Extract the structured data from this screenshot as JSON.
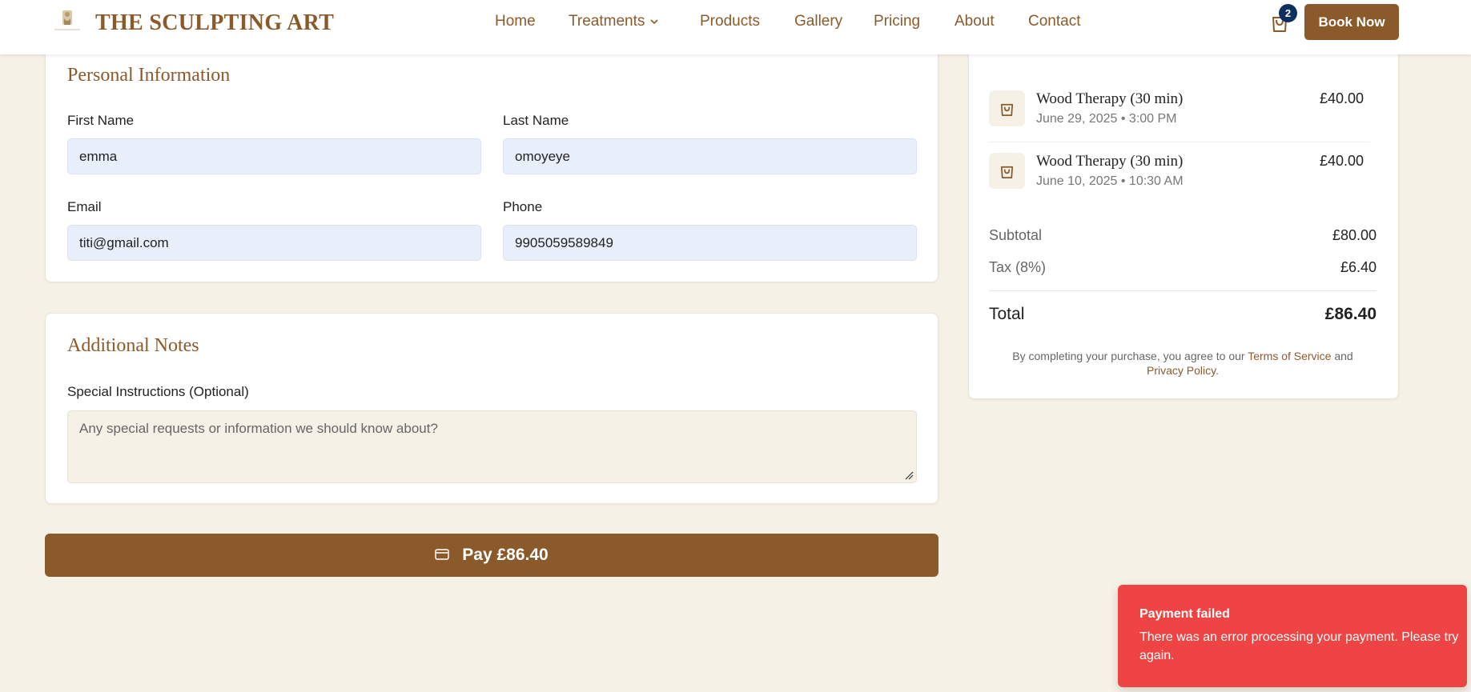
{
  "header": {
    "brand": "THE SCULPTING ART",
    "nav": [
      {
        "label": "Home"
      },
      {
        "label": "Treatments"
      },
      {
        "label": "Products"
      },
      {
        "label": "Gallery"
      },
      {
        "label": "Pricing"
      },
      {
        "label": "About"
      },
      {
        "label": "Contact"
      }
    ],
    "cart_count": "2",
    "book_label": "Book Now"
  },
  "personal": {
    "title": "Personal Information",
    "first_name_label": "First Name",
    "first_name_value": "emma",
    "last_name_label": "Last Name",
    "last_name_value": "omoyeye",
    "email_label": "Email",
    "email_value": "titi@gmail.com",
    "phone_label": "Phone",
    "phone_value": "9905059589849"
  },
  "notes": {
    "title": "Additional Notes",
    "label": "Special Instructions (Optional)",
    "placeholder": "Any special requests or information we should know about?"
  },
  "pay_button": "Pay £86.40",
  "summary": {
    "items": [
      {
        "name": "Wood Therapy (30 min)",
        "date": "June 29, 2025 • 3:00 PM",
        "price": "£40.00"
      },
      {
        "name": "Wood Therapy (30 min)",
        "date": "June 10, 2025 • 10:30 AM",
        "price": "£40.00"
      }
    ],
    "subtotal_label": "Subtotal",
    "subtotal_value": "£80.00",
    "tax_label": "Tax (8%)",
    "tax_value": "£6.40",
    "total_label": "Total",
    "total_value": "£86.40",
    "legal_prefix": "By completing your purchase, you agree to our",
    "terms": "Terms of Service",
    "legal_and": "and",
    "privacy": "Privacy Policy",
    "legal_suffix": "."
  },
  "toast": {
    "title": "Payment failed",
    "message": "There was an error processing your payment. Please try again."
  },
  "colors": {
    "accent": "#8b5a2b",
    "background": "#f6f1e6",
    "input_fill": "#e8effa",
    "error": "#ef4444",
    "badge": "#0f2f5f"
  }
}
